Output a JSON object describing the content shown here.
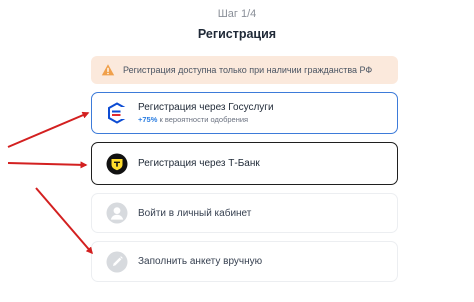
{
  "header": {
    "step": "Шаг 1/4",
    "title": "Регистрация"
  },
  "notice": {
    "text": "Регистрация доступна только при наличии гражданства РФ",
    "icon": "warning-triangle-icon",
    "color": "#f0a04b"
  },
  "options": {
    "gosuslugi": {
      "label": "Регистрация через Госуслуги",
      "sub_percent": "+75%",
      "sub_text": " к вероятности одобрения",
      "icon": "gosuslugi-logo-icon"
    },
    "tbank": {
      "label": "Регистрация через Т-Банк",
      "icon": "tbank-logo-icon"
    },
    "cabinet": {
      "label": "Войти в личный кабинет",
      "icon": "user-avatar-icon"
    },
    "manual": {
      "label": "Заполнить анкету вручную",
      "icon": "pencil-icon"
    }
  },
  "colors": {
    "accent_blue": "#3d7bd9",
    "arrow_red": "#d32020",
    "tbank_yellow": "#ffdd2d"
  }
}
